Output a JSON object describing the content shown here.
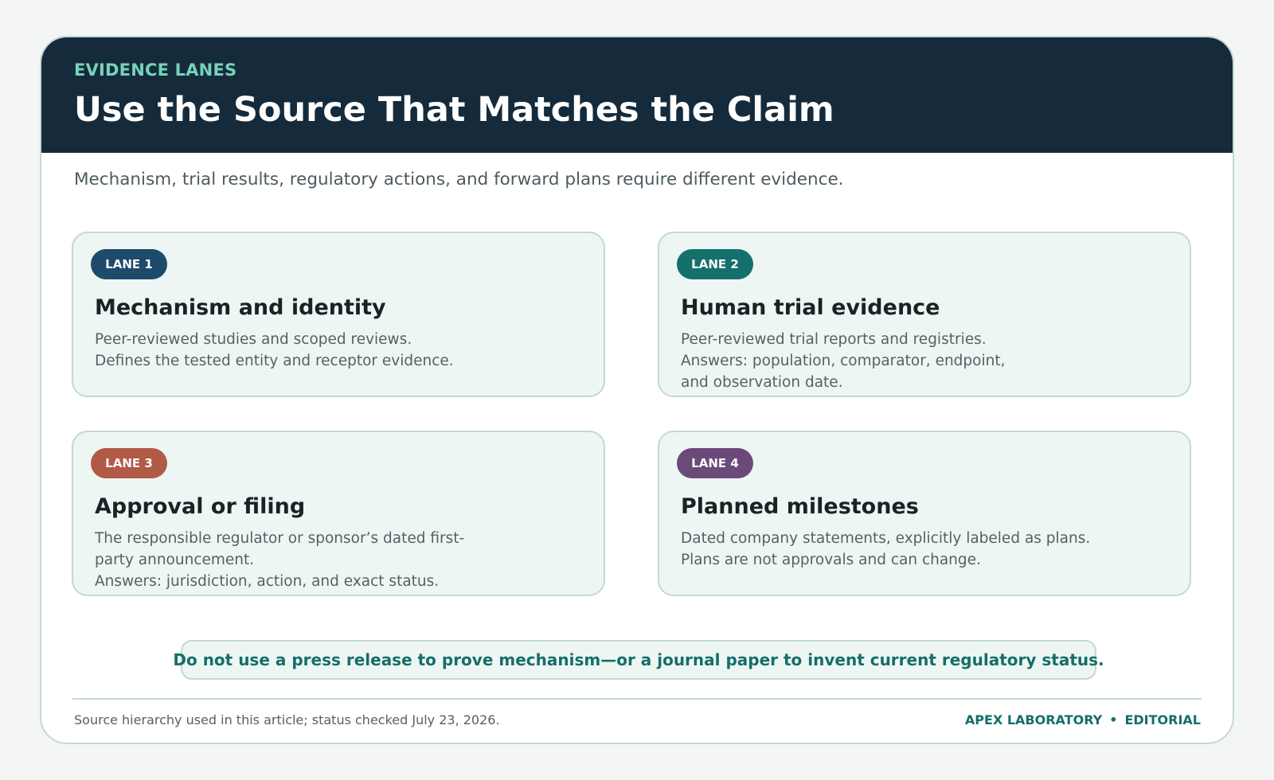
{
  "header": {
    "eyebrow": "EVIDENCE LANES",
    "title": "Use the Source That Matches the Claim"
  },
  "subtitle": "Mechanism, trial results, regulatory actions, and forward plans require different evidence.",
  "lanes": [
    {
      "badge": "LANE 1",
      "badge_color": "#1e4a6b",
      "title": "Mechanism and identity",
      "lines": [
        "Peer-reviewed studies and scoped reviews.",
        "Defines the tested entity and receptor evidence."
      ]
    },
    {
      "badge": "LANE 2",
      "badge_color": "#15706b",
      "title": "Human trial evidence",
      "lines": [
        "Peer-reviewed trial reports and registries.",
        "Answers: population, comparator, endpoint, and observation date."
      ]
    },
    {
      "badge": "LANE 3",
      "badge_color": "#b05a47",
      "title": "Approval or filing",
      "lines": [
        "The responsible regulator or sponsor’s dated first-party announcement.",
        "Answers: jurisdiction, action, and exact status."
      ]
    },
    {
      "badge": "LANE 4",
      "badge_color": "#6b4a7a",
      "title": "Planned milestones",
      "lines": [
        "Dated company statements, explicitly labeled as plans.",
        "Plans are not approvals and can change."
      ]
    }
  ],
  "callout": "Do not use a press release to prove mechanism—or a journal paper to invent current regulatory status.",
  "footer": {
    "note": "Source hierarchy used in this article; status checked July 23, 2026.",
    "brand": "APEX LABORATORY",
    "separator": "•",
    "section": "EDITORIAL"
  },
  "colors": {
    "header_bg": "#152b3b",
    "accent_green": "#76d3b8",
    "accent_teal": "#156e6a",
    "card_border": "#c2d9d4",
    "lane_bg": "#eef6f4"
  }
}
